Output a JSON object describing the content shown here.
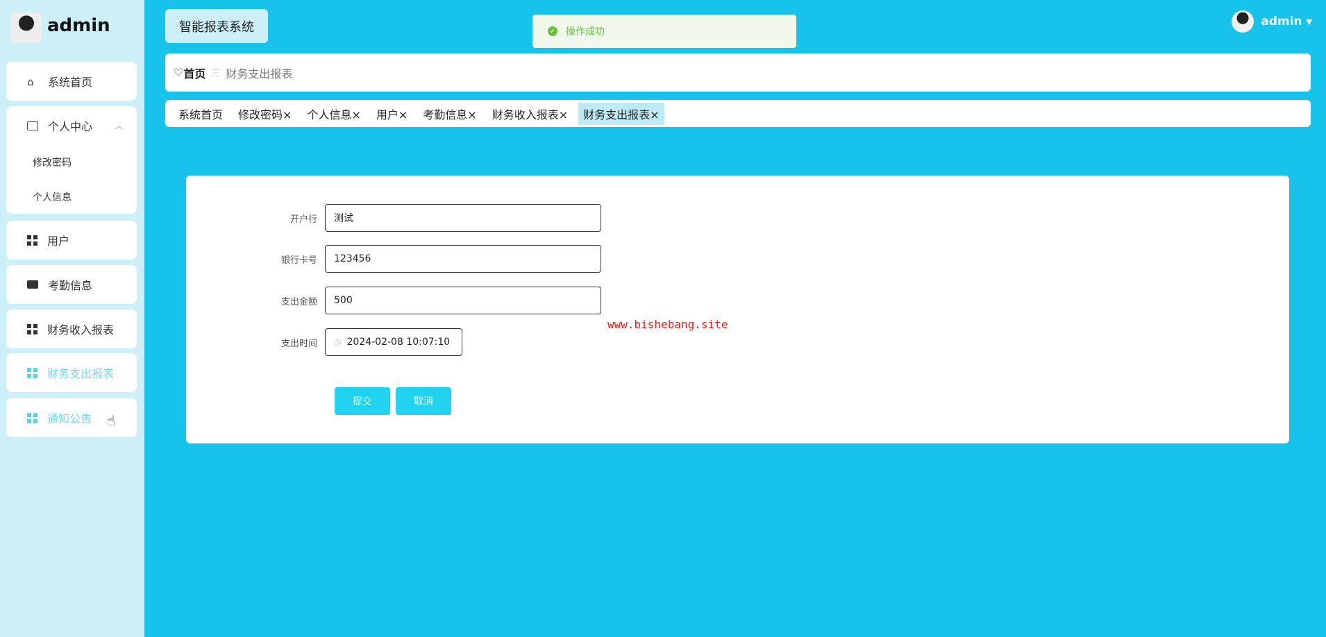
{
  "sidebar": {
    "user_name": "admin",
    "items": [
      {
        "label": "系统首页"
      },
      {
        "label": "个人中心",
        "children": [
          {
            "label": "修改密码"
          },
          {
            "label": "个人信息"
          }
        ]
      },
      {
        "label": "用户"
      },
      {
        "label": "考勤信息"
      },
      {
        "label": "财务收入报表"
      },
      {
        "label": "财务支出报表"
      },
      {
        "label": "通知公告"
      }
    ]
  },
  "header": {
    "title": "智能报表系统",
    "user": "admin"
  },
  "toast": {
    "message": "操作成功",
    "color": "#67c23a"
  },
  "breadcrumb": {
    "home": "首页",
    "separator": "三",
    "current": "财务支出报表"
  },
  "tabs": [
    {
      "label": "系统首页",
      "close": ""
    },
    {
      "label": "修改密码",
      "close": "×"
    },
    {
      "label": "个人信息",
      "close": "×"
    },
    {
      "label": "用户",
      "close": "×"
    },
    {
      "label": "考勤信息",
      "close": "×"
    },
    {
      "label": "财务收入报表",
      "close": "×"
    },
    {
      "label": "财务支出报表",
      "close": "×"
    }
  ],
  "form": {
    "fields": [
      {
        "label": "开户行",
        "value": "测试"
      },
      {
        "label": "银行卡号",
        "value": "123456"
      },
      {
        "label": "支出金额",
        "value": "500"
      },
      {
        "label": "支出时间",
        "value": "2024-02-08 10:07:10"
      }
    ],
    "submit": "提交",
    "cancel": "取消"
  },
  "watermark": "www.bishebang.site",
  "colors": {
    "main_bg": "#17c3eb",
    "sidebar_bg": "#cdeff8",
    "accent": "#22d3f0"
  }
}
